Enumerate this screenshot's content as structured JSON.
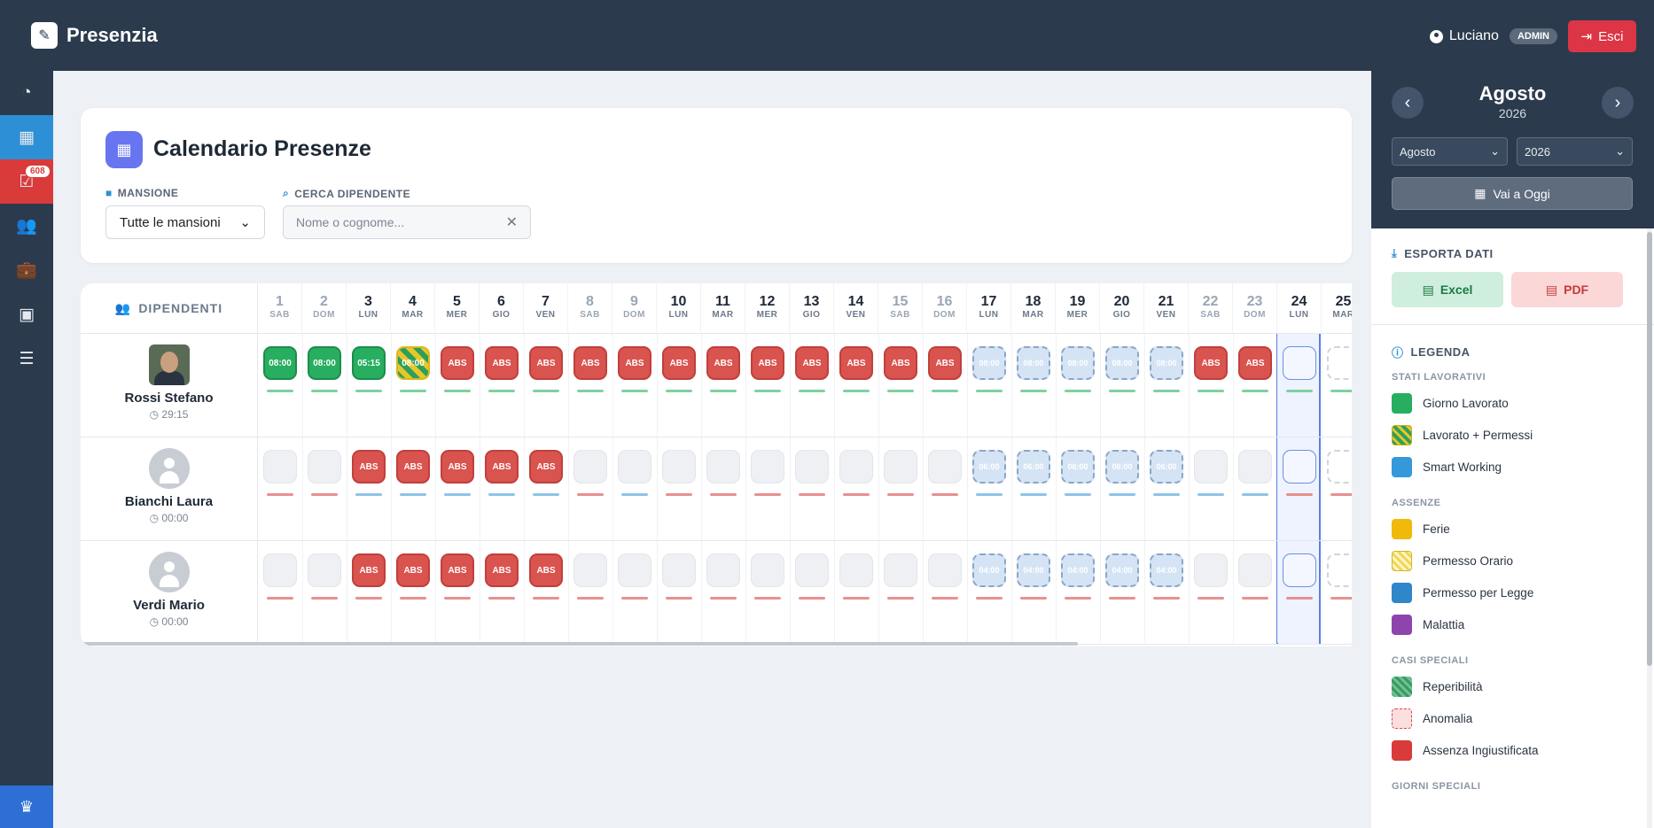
{
  "app": {
    "name": "Presenzia"
  },
  "user": {
    "name": "Luciano",
    "role": "ADMIN",
    "logout_label": "Esci"
  },
  "sidebar": {
    "notification_count": "608"
  },
  "page": {
    "title": "Calendario Presenze"
  },
  "filters": {
    "mansione_label": "MANSIONE",
    "mansione_value": "Tutte le mansioni",
    "search_label": "CERCA DIPENDENTE",
    "search_placeholder": "Nome o cognome..."
  },
  "grid": {
    "employees_header": "DIPENDENTI",
    "days": [
      {
        "n": "1",
        "w": "SAB",
        "we": true
      },
      {
        "n": "2",
        "w": "DOM",
        "we": true
      },
      {
        "n": "3",
        "w": "LUN"
      },
      {
        "n": "4",
        "w": "MAR"
      },
      {
        "n": "5",
        "w": "MER"
      },
      {
        "n": "6",
        "w": "GIO"
      },
      {
        "n": "7",
        "w": "VEN"
      },
      {
        "n": "8",
        "w": "SAB",
        "we": true
      },
      {
        "n": "9",
        "w": "DOM",
        "we": true
      },
      {
        "n": "10",
        "w": "LUN"
      },
      {
        "n": "11",
        "w": "MAR"
      },
      {
        "n": "12",
        "w": "MER"
      },
      {
        "n": "13",
        "w": "GIO"
      },
      {
        "n": "14",
        "w": "VEN"
      },
      {
        "n": "15",
        "w": "SAB",
        "we": true
      },
      {
        "n": "16",
        "w": "DOM",
        "we": true
      },
      {
        "n": "17",
        "w": "LUN"
      },
      {
        "n": "18",
        "w": "MAR"
      },
      {
        "n": "19",
        "w": "MER"
      },
      {
        "n": "20",
        "w": "GIO"
      },
      {
        "n": "21",
        "w": "VEN"
      },
      {
        "n": "22",
        "w": "SAB",
        "we": true
      },
      {
        "n": "23",
        "w": "DOM",
        "we": true
      },
      {
        "n": "24",
        "w": "LUN"
      },
      {
        "n": "25",
        "w": "MAR"
      }
    ],
    "employees": [
      {
        "name": "Rossi Stefano",
        "hours": "29:15",
        "avatar": "photo",
        "cells": [
          [
            "work",
            "08:00",
            "g"
          ],
          [
            "work",
            "08:00",
            "g"
          ],
          [
            "work",
            "05:15",
            "g"
          ],
          [
            "perm",
            "08:00",
            "g"
          ],
          [
            "abs",
            "ABS",
            "g"
          ],
          [
            "abs",
            "ABS",
            "g"
          ],
          [
            "abs",
            "ABS",
            "g"
          ],
          [
            "abs",
            "ABS",
            "g"
          ],
          [
            "abs",
            "ABS",
            "g"
          ],
          [
            "abs",
            "ABS",
            "g"
          ],
          [
            "abs",
            "ABS",
            "g"
          ],
          [
            "abs",
            "ABS",
            "g"
          ],
          [
            "abs",
            "ABS",
            "g"
          ],
          [
            "abs",
            "ABS",
            "g"
          ],
          [
            "abs",
            "ABS",
            "g"
          ],
          [
            "abs",
            "ABS",
            "g"
          ],
          [
            "plan",
            "08:00",
            "g"
          ],
          [
            "plan",
            "08:00",
            "g"
          ],
          [
            "plan",
            "08:00",
            "g"
          ],
          [
            "plan",
            "08:00",
            "g"
          ],
          [
            "plan",
            "08:00",
            "g"
          ],
          [
            "abs",
            "ABS",
            "g"
          ],
          [
            "abs",
            "ABS",
            "g"
          ],
          [
            "today",
            "",
            "g"
          ],
          [
            "future",
            "",
            "g"
          ]
        ]
      },
      {
        "name": "Bianchi Laura",
        "hours": "00:00",
        "avatar": "gen",
        "cells": [
          [
            "empty",
            "",
            "r"
          ],
          [
            "empty",
            "",
            "r"
          ],
          [
            "abs",
            "ABS",
            "b"
          ],
          [
            "abs",
            "ABS",
            "b"
          ],
          [
            "abs",
            "ABS",
            "b"
          ],
          [
            "abs",
            "ABS",
            "b"
          ],
          [
            "abs",
            "ABS",
            "b"
          ],
          [
            "empty",
            "",
            "r"
          ],
          [
            "empty",
            "",
            "b"
          ],
          [
            "empty",
            "",
            "r"
          ],
          [
            "empty",
            "",
            "r"
          ],
          [
            "empty",
            "",
            "r"
          ],
          [
            "empty",
            "",
            "r"
          ],
          [
            "empty",
            "",
            "r"
          ],
          [
            "empty",
            "",
            "r"
          ],
          [
            "empty",
            "",
            "r"
          ],
          [
            "plan",
            "06:00",
            "b"
          ],
          [
            "plan",
            "06:00",
            "b"
          ],
          [
            "plan",
            "06:00",
            "b"
          ],
          [
            "plan",
            "06:00",
            "b"
          ],
          [
            "plan",
            "06:00",
            "b"
          ],
          [
            "empty",
            "",
            "b"
          ],
          [
            "empty",
            "",
            "b"
          ],
          [
            "today",
            "",
            "r"
          ],
          [
            "future",
            "",
            "r"
          ]
        ]
      },
      {
        "name": "Verdi Mario",
        "hours": "00:00",
        "avatar": "gen",
        "cells": [
          [
            "empty",
            "",
            "r"
          ],
          [
            "empty",
            "",
            "r"
          ],
          [
            "abs",
            "ABS",
            "r"
          ],
          [
            "abs",
            "ABS",
            "r"
          ],
          [
            "abs",
            "ABS",
            "r"
          ],
          [
            "abs",
            "ABS",
            "r"
          ],
          [
            "abs",
            "ABS",
            "r"
          ],
          [
            "empty",
            "",
            "r"
          ],
          [
            "empty",
            "",
            "r"
          ],
          [
            "empty",
            "",
            "r"
          ],
          [
            "empty",
            "",
            "r"
          ],
          [
            "empty",
            "",
            "r"
          ],
          [
            "empty",
            "",
            "r"
          ],
          [
            "empty",
            "",
            "r"
          ],
          [
            "empty",
            "",
            "r"
          ],
          [
            "empty",
            "",
            "r"
          ],
          [
            "plan",
            "04:00",
            "r"
          ],
          [
            "plan",
            "04:00",
            "r"
          ],
          [
            "plan",
            "04:00",
            "r"
          ],
          [
            "plan",
            "04:00",
            "r"
          ],
          [
            "plan",
            "04:00",
            "r"
          ],
          [
            "empty",
            "",
            "r"
          ],
          [
            "empty",
            "",
            "r"
          ],
          [
            "today",
            "",
            "r"
          ],
          [
            "future",
            "",
            "r"
          ]
        ]
      }
    ]
  },
  "right_panel": {
    "month": "Agosto",
    "year": "2026",
    "month_select": "Agosto",
    "year_select": "2026",
    "today_button": "Vai a Oggi",
    "export_title": "ESPORTA DATI",
    "excel_label": "Excel",
    "pdf_label": "PDF",
    "legend_title": "LEGENDA",
    "legend_groups": [
      {
        "title": "STATI LAVORATIVI",
        "items": [
          {
            "label": "Giorno Lavorato",
            "color": "#27ae60",
            "style": "solid"
          },
          {
            "label": "Lavorato + Permessi",
            "color": "#2ca05a",
            "style": "stripe-yg"
          },
          {
            "label": "Smart Working",
            "color": "#3498db",
            "style": "solid"
          }
        ]
      },
      {
        "title": "ASSENZE",
        "items": [
          {
            "label": "Ferie",
            "color": "#f1b90c",
            "style": "solid"
          },
          {
            "label": "Permesso Orario",
            "color": "#e8c62a",
            "style": "stripe-y"
          },
          {
            "label": "Permesso per Legge",
            "color": "#2f86c9",
            "style": "solid"
          },
          {
            "label": "Malattia",
            "color": "#8e44ad",
            "style": "solid"
          }
        ]
      },
      {
        "title": "CASI SPECIALI",
        "items": [
          {
            "label": "Reperibilità",
            "color": "#3c9a64",
            "style": "stripe-g"
          },
          {
            "label": "Anomalia",
            "color": "#fbdede",
            "style": "dashed-red"
          },
          {
            "label": "Assenza Ingiustificata",
            "color": "#d93a3a",
            "style": "solid"
          }
        ]
      },
      {
        "title": "GIORNI SPECIALI",
        "items": []
      }
    ]
  }
}
